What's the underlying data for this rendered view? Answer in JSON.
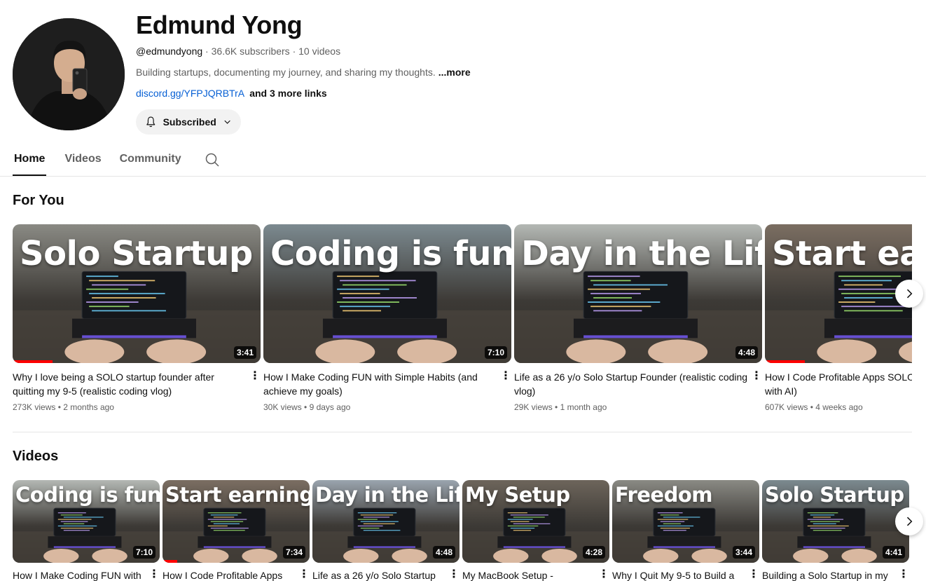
{
  "channel": {
    "name": "Edmund Yong",
    "handle": "@edmundyong",
    "subscribers": "36.6K subscribers",
    "videos_count": "10 videos",
    "separator": " · ",
    "description": "Building startups, documenting my journey, and sharing my thoughts.",
    "more_label": "...more",
    "link": "discord.gg/YFPJQRBTrA",
    "more_links": "and 3 more links",
    "subscribe_label": "Subscribed"
  },
  "tabs": [
    {
      "label": "Home",
      "active": true
    },
    {
      "label": "Videos",
      "active": false
    },
    {
      "label": "Community",
      "active": false
    }
  ],
  "sections": {
    "for_you": "For You",
    "videos": "Videos"
  },
  "for_you": [
    {
      "overlay": "Solo Startup",
      "duration": "3:41",
      "title": "Why I love being a SOLO startup founder after quitting my 9-5 (realistic coding vlog)",
      "views": "273K views",
      "age": "2 months ago",
      "progress": 0.16
    },
    {
      "overlay": "Coding is fun",
      "duration": "7:10",
      "title": "How I Make Coding FUN with Simple Habits (and achieve my goals)",
      "views": "30K views",
      "age": "9 days ago",
      "progress": 0
    },
    {
      "overlay": "Day in the Life",
      "duration": "4:48",
      "title": "Life as a 26 y/o Solo Startup Founder (realistic coding vlog)",
      "views": "29K views",
      "age": "1 month ago",
      "progress": 0
    },
    {
      "overlay": "Start ea",
      "duration": "",
      "title": "How I Code Profitable Apps SOLO beginner friendly / with AI)",
      "views": "607K views",
      "age": "4 weeks ago",
      "progress": 0.16
    }
  ],
  "videos": [
    {
      "overlay": "Coding is fun",
      "duration": "7:10",
      "title": "How I Make Coding FUN with",
      "progress": 0
    },
    {
      "overlay": "Start earning",
      "duration": "7:34",
      "title": "How I Code Profitable Apps",
      "progress": 0.1
    },
    {
      "overlay": "Day in the Life",
      "duration": "4:48",
      "title": "Life as a 26 y/o Solo Startup",
      "progress": 0
    },
    {
      "overlay": "My Setup",
      "duration": "4:28",
      "title": "My MacBook Setup -",
      "progress": 0
    },
    {
      "overlay": "Freedom",
      "duration": "3:44",
      "title": "Why I Quit My 9-5 to Build a",
      "progress": 0
    },
    {
      "overlay": "Solo Startup",
      "duration": "4:41",
      "title": "Building a Solo Startup in my",
      "progress": 0
    }
  ],
  "stats_separator": " • ",
  "menu_glyph": "⋮",
  "colors": {
    "link": "#065fd4",
    "progress": "#ff0000",
    "muted": "#606060"
  }
}
